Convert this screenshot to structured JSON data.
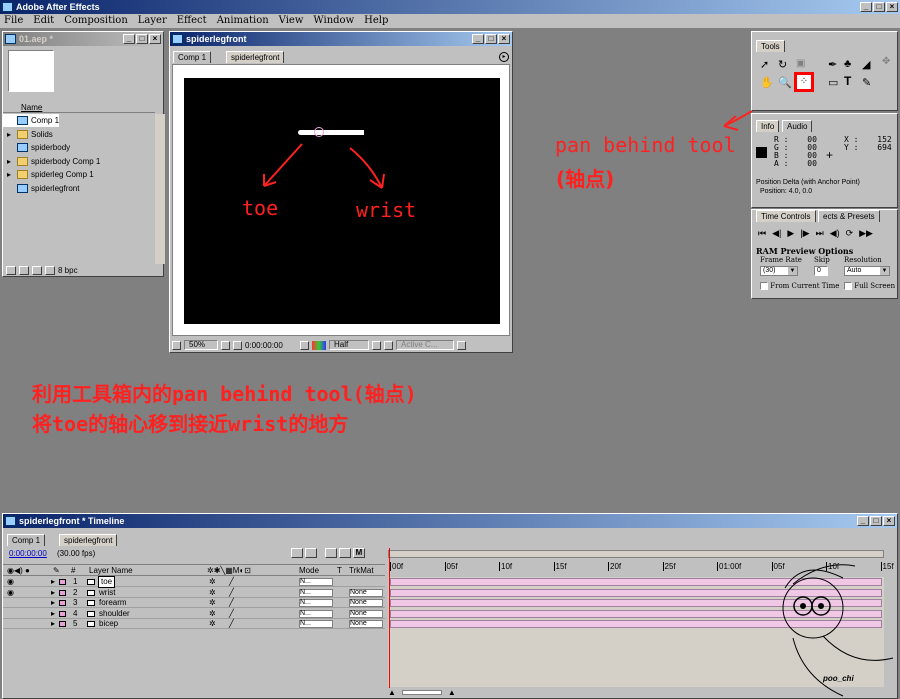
{
  "app": {
    "title": "Adobe After Effects",
    "menu": [
      "File",
      "Edit",
      "Composition",
      "Layer",
      "Effect",
      "Animation",
      "View",
      "Window",
      "Help"
    ]
  },
  "project": {
    "title": "01.aep *",
    "column_name": "Name",
    "items": [
      {
        "name": "Comp 1",
        "type": "comp",
        "expand": false
      },
      {
        "name": "Solids",
        "type": "folder",
        "expand": true
      },
      {
        "name": "spiderbody",
        "type": "comp",
        "expand": false
      },
      {
        "name": "spiderbody Comp 1",
        "type": "folder",
        "expand": true
      },
      {
        "name": "spiderleg Comp 1",
        "type": "folder",
        "expand": true
      },
      {
        "name": "spiderlegfront",
        "type": "comp",
        "expand": false
      }
    ],
    "bpc": "8 bpc"
  },
  "comp": {
    "title": "spiderlegfront",
    "tabs": [
      "Comp 1",
      "spiderlegfront"
    ],
    "zoom": "50%",
    "timecode": "0:00:00:00",
    "resolution": "Half",
    "camera": "Active C..."
  },
  "annotations": {
    "toe": "toe",
    "wrist": "wrist",
    "tool_label": "pan behind tool",
    "tool_sub": "(轴点)",
    "line1": "利用工具箱内的pan behind tool(轴点)",
    "line2": "将toe的轴心移到接近wrist的地方"
  },
  "tools": {
    "title": "Tools"
  },
  "info": {
    "tabs": [
      "Info",
      "Audio"
    ],
    "r": "R :",
    "r_val": "00",
    "g": "G :",
    "g_val": "00",
    "b": "B :",
    "b_val": "00",
    "a": "A :",
    "a_val": "00",
    "x": "X :",
    "x_val": "152",
    "y": "Y :",
    "y_val": "694",
    "delta": "Position Delta (with Anchor Point)",
    "pos": "Position: 4.0, 0.0"
  },
  "time_controls": {
    "tabs": [
      "Time Controls",
      "ects & Presets"
    ],
    "ram_title": "RAM Preview Options",
    "frame_rate_label": "Frame Rate",
    "frame_rate": "(30)",
    "skip_label": "Skip",
    "skip": "0",
    "resolution_label": "Resolution",
    "resolution": "Auto",
    "from_current": "From Current Time",
    "full_screen": "Full Screen"
  },
  "timeline": {
    "title": "spiderlegfront * Timeline",
    "tabs": [
      "Comp 1",
      "spiderlegfront"
    ],
    "timecode": "0:00:00:00",
    "fps": "(30.00 fps)",
    "col_num": "#",
    "col_name": "Layer Name",
    "col_mode": "Mode",
    "col_t": "T",
    "col_trkmat": "TrkMat",
    "ticks": [
      "00f",
      "05f",
      "10f",
      "15f",
      "20f",
      "25f",
      "01:00f",
      "05f",
      "10f",
      "15f"
    ],
    "layers": [
      {
        "num": "1",
        "name": "toe",
        "mode": "N...",
        "trkmat": "",
        "eye": true
      },
      {
        "num": "2",
        "name": "wrist",
        "mode": "N...",
        "trkmat": "None",
        "eye": true
      },
      {
        "num": "3",
        "name": "forearm",
        "mode": "N...",
        "trkmat": "None",
        "eye": false
      },
      {
        "num": "4",
        "name": "shoulder",
        "mode": "N...",
        "trkmat": "None",
        "eye": false
      },
      {
        "num": "5",
        "name": "bicep",
        "mode": "N...",
        "trkmat": "None",
        "eye": false
      }
    ],
    "signature": "poo_chi"
  },
  "colors": {
    "accent_red": "#ff2020",
    "layer_bar": "#f0c8e6",
    "titlebar": "#0a246a"
  }
}
